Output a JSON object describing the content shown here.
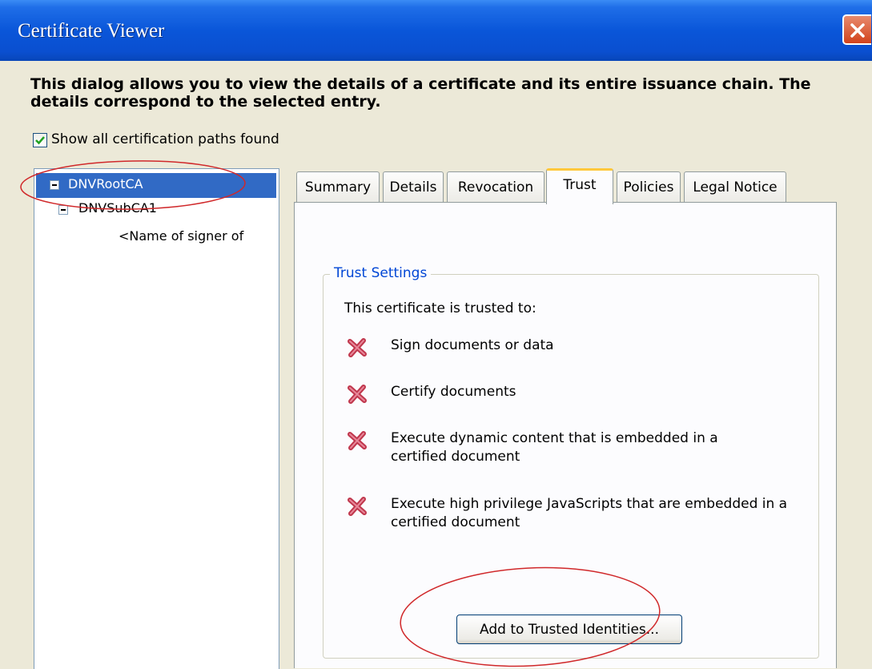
{
  "window": {
    "title": "Certificate Viewer",
    "close_icon": "close-icon"
  },
  "intro_text": "This dialog allows you to view the details of a certificate and its entire issuance chain. The details correspond to the selected entry.",
  "show_all_paths": {
    "label": "Show all certification paths found",
    "checked": true
  },
  "tree": {
    "items": [
      {
        "label": "DNVRootCA",
        "selected": true
      },
      {
        "label": "DNVSubCA1",
        "selected": false
      },
      {
        "label": "<Name of signer of",
        "selected": false
      }
    ]
  },
  "tabs": [
    {
      "label": "Summary",
      "active": false
    },
    {
      "label": "Details",
      "active": false
    },
    {
      "label": "Revocation",
      "active": false
    },
    {
      "label": "Trust",
      "active": true
    },
    {
      "label": "Policies",
      "active": false
    },
    {
      "label": "Legal Notice",
      "active": false
    }
  ],
  "trust_settings": {
    "legend": "Trust Settings",
    "heading": "This certificate is trusted to:",
    "permissions": [
      {
        "icon": "red-x-icon",
        "text": "Sign documents or data"
      },
      {
        "icon": "red-x-icon",
        "text": "Certify documents"
      },
      {
        "icon": "red-x-icon",
        "text": "Execute dynamic content that is embedded in a certified document"
      },
      {
        "icon": "red-x-icon",
        "text": "Execute high privilege JavaScripts that are embedded in a certified document"
      }
    ],
    "add_button_label": "Add to Trusted Identities..."
  },
  "colors": {
    "title_bar": "#0a56d9",
    "selection": "#316ac5",
    "legend_text": "#0046d5",
    "active_tab_accent": "#ffc83c",
    "annotation_ellipse": "#d0282a"
  }
}
